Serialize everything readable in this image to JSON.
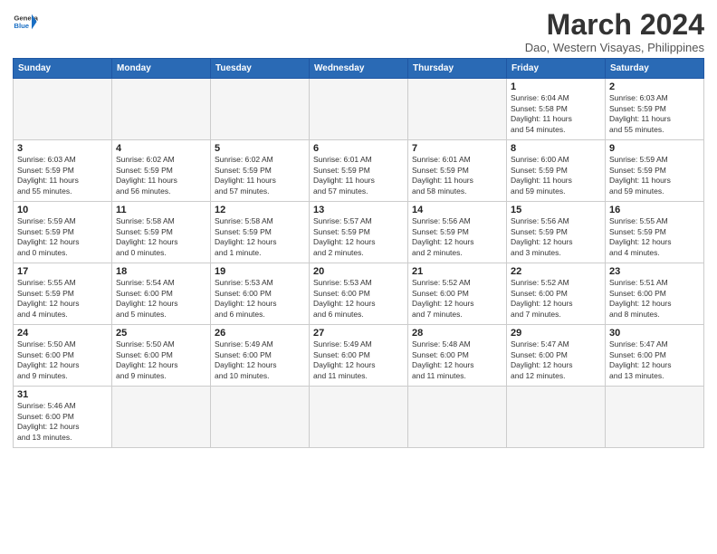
{
  "header": {
    "logo_general": "General",
    "logo_blue": "Blue",
    "month_title": "March 2024",
    "subtitle": "Dao, Western Visayas, Philippines"
  },
  "weekdays": [
    "Sunday",
    "Monday",
    "Tuesday",
    "Wednesday",
    "Thursday",
    "Friday",
    "Saturday"
  ],
  "weeks": [
    [
      {
        "day": "",
        "info": ""
      },
      {
        "day": "",
        "info": ""
      },
      {
        "day": "",
        "info": ""
      },
      {
        "day": "",
        "info": ""
      },
      {
        "day": "",
        "info": ""
      },
      {
        "day": "1",
        "info": "Sunrise: 6:04 AM\nSunset: 5:58 PM\nDaylight: 11 hours\nand 54 minutes."
      },
      {
        "day": "2",
        "info": "Sunrise: 6:03 AM\nSunset: 5:59 PM\nDaylight: 11 hours\nand 55 minutes."
      }
    ],
    [
      {
        "day": "3",
        "info": "Sunrise: 6:03 AM\nSunset: 5:59 PM\nDaylight: 11 hours\nand 55 minutes."
      },
      {
        "day": "4",
        "info": "Sunrise: 6:02 AM\nSunset: 5:59 PM\nDaylight: 11 hours\nand 56 minutes."
      },
      {
        "day": "5",
        "info": "Sunrise: 6:02 AM\nSunset: 5:59 PM\nDaylight: 11 hours\nand 57 minutes."
      },
      {
        "day": "6",
        "info": "Sunrise: 6:01 AM\nSunset: 5:59 PM\nDaylight: 11 hours\nand 57 minutes."
      },
      {
        "day": "7",
        "info": "Sunrise: 6:01 AM\nSunset: 5:59 PM\nDaylight: 11 hours\nand 58 minutes."
      },
      {
        "day": "8",
        "info": "Sunrise: 6:00 AM\nSunset: 5:59 PM\nDaylight: 11 hours\nand 59 minutes."
      },
      {
        "day": "9",
        "info": "Sunrise: 5:59 AM\nSunset: 5:59 PM\nDaylight: 11 hours\nand 59 minutes."
      }
    ],
    [
      {
        "day": "10",
        "info": "Sunrise: 5:59 AM\nSunset: 5:59 PM\nDaylight: 12 hours\nand 0 minutes."
      },
      {
        "day": "11",
        "info": "Sunrise: 5:58 AM\nSunset: 5:59 PM\nDaylight: 12 hours\nand 0 minutes."
      },
      {
        "day": "12",
        "info": "Sunrise: 5:58 AM\nSunset: 5:59 PM\nDaylight: 12 hours\nand 1 minute."
      },
      {
        "day": "13",
        "info": "Sunrise: 5:57 AM\nSunset: 5:59 PM\nDaylight: 12 hours\nand 2 minutes."
      },
      {
        "day": "14",
        "info": "Sunrise: 5:56 AM\nSunset: 5:59 PM\nDaylight: 12 hours\nand 2 minutes."
      },
      {
        "day": "15",
        "info": "Sunrise: 5:56 AM\nSunset: 5:59 PM\nDaylight: 12 hours\nand 3 minutes."
      },
      {
        "day": "16",
        "info": "Sunrise: 5:55 AM\nSunset: 5:59 PM\nDaylight: 12 hours\nand 4 minutes."
      }
    ],
    [
      {
        "day": "17",
        "info": "Sunrise: 5:55 AM\nSunset: 5:59 PM\nDaylight: 12 hours\nand 4 minutes."
      },
      {
        "day": "18",
        "info": "Sunrise: 5:54 AM\nSunset: 6:00 PM\nDaylight: 12 hours\nand 5 minutes."
      },
      {
        "day": "19",
        "info": "Sunrise: 5:53 AM\nSunset: 6:00 PM\nDaylight: 12 hours\nand 6 minutes."
      },
      {
        "day": "20",
        "info": "Sunrise: 5:53 AM\nSunset: 6:00 PM\nDaylight: 12 hours\nand 6 minutes."
      },
      {
        "day": "21",
        "info": "Sunrise: 5:52 AM\nSunset: 6:00 PM\nDaylight: 12 hours\nand 7 minutes."
      },
      {
        "day": "22",
        "info": "Sunrise: 5:52 AM\nSunset: 6:00 PM\nDaylight: 12 hours\nand 7 minutes."
      },
      {
        "day": "23",
        "info": "Sunrise: 5:51 AM\nSunset: 6:00 PM\nDaylight: 12 hours\nand 8 minutes."
      }
    ],
    [
      {
        "day": "24",
        "info": "Sunrise: 5:50 AM\nSunset: 6:00 PM\nDaylight: 12 hours\nand 9 minutes."
      },
      {
        "day": "25",
        "info": "Sunrise: 5:50 AM\nSunset: 6:00 PM\nDaylight: 12 hours\nand 9 minutes."
      },
      {
        "day": "26",
        "info": "Sunrise: 5:49 AM\nSunset: 6:00 PM\nDaylight: 12 hours\nand 10 minutes."
      },
      {
        "day": "27",
        "info": "Sunrise: 5:49 AM\nSunset: 6:00 PM\nDaylight: 12 hours\nand 11 minutes."
      },
      {
        "day": "28",
        "info": "Sunrise: 5:48 AM\nSunset: 6:00 PM\nDaylight: 12 hours\nand 11 minutes."
      },
      {
        "day": "29",
        "info": "Sunrise: 5:47 AM\nSunset: 6:00 PM\nDaylight: 12 hours\nand 12 minutes."
      },
      {
        "day": "30",
        "info": "Sunrise: 5:47 AM\nSunset: 6:00 PM\nDaylight: 12 hours\nand 13 minutes."
      }
    ],
    [
      {
        "day": "31",
        "info": "Sunrise: 5:46 AM\nSunset: 6:00 PM\nDaylight: 12 hours\nand 13 minutes."
      },
      {
        "day": "",
        "info": ""
      },
      {
        "day": "",
        "info": ""
      },
      {
        "day": "",
        "info": ""
      },
      {
        "day": "",
        "info": ""
      },
      {
        "day": "",
        "info": ""
      },
      {
        "day": "",
        "info": ""
      }
    ]
  ]
}
